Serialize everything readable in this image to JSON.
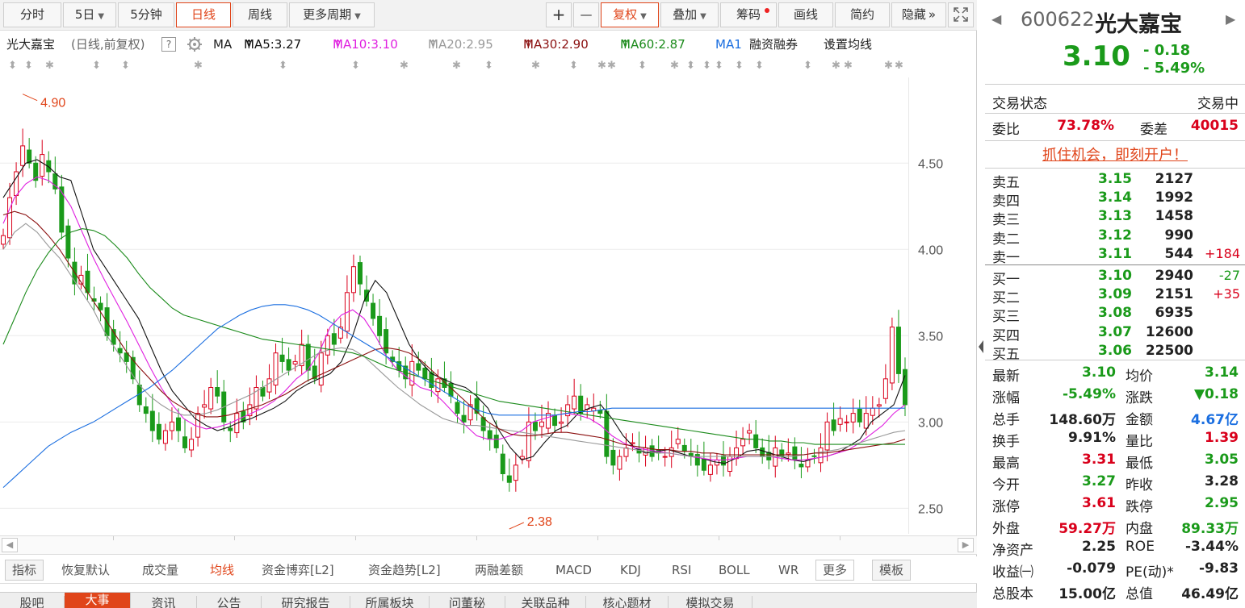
{
  "toolbar": {
    "periods": [
      "分时",
      "5日",
      "5分钟",
      "日线",
      "周线",
      "更多周期"
    ],
    "active_period": "日线",
    "tools": [
      "+",
      "—",
      "复权",
      "叠加",
      "筹码",
      "画线",
      "简约",
      "隐藏"
    ],
    "hide_arrow": "»",
    "fullscreen_icon": "fullscreen-icon"
  },
  "ma_legend": {
    "stock": "光大嘉宝",
    "mode": "(日线,前复权)",
    "help": "?",
    "label": "MA",
    "items": [
      {
        "text": "MA5:3.27",
        "arrow": "↑",
        "color": "#111111"
      },
      {
        "text": "MA10:3.10",
        "arrow": "↑",
        "color": "#e020e0"
      },
      {
        "text": "MA20:2.95",
        "arrow": "↑",
        "color": "#999999"
      },
      {
        "text": "MA30:2.90",
        "arrow": "↑",
        "color": "#8b1010"
      },
      {
        "text": "MA60:2.87",
        "arrow": "↑",
        "color": "#1a8a1a"
      },
      {
        "text": "MA1",
        "arrow": "",
        "color": "#1a6ee0"
      }
    ],
    "margin": "融资融券",
    "set_ma": "设置均线"
  },
  "marker_glyphs": [
    "⬍",
    "✱"
  ],
  "chart_data": {
    "type": "candlestick",
    "ylim": [
      2.38,
      4.95
    ],
    "yticks": [
      "4.50",
      "4.00",
      "3.50",
      "3.00",
      "2.50"
    ],
    "ytick_values": [
      4.5,
      4.0,
      3.5,
      3.0,
      2.5
    ],
    "annotations": [
      {
        "text": "4.90",
        "value": 4.9
      },
      {
        "text": "2.38",
        "value": 2.38
      }
    ],
    "colors": {
      "up": "#d9001b",
      "down": "#1a9a1a",
      "grid": "#ececec"
    },
    "close": [
      4.08,
      4.3,
      4.45,
      4.6,
      4.5,
      4.4,
      4.55,
      4.45,
      4.35,
      4.1,
      3.95,
      3.8,
      3.85,
      3.75,
      3.7,
      3.65,
      3.5,
      3.45,
      3.4,
      3.35,
      3.25,
      3.1,
      3.05,
      2.95,
      2.9,
      2.95,
      3.0,
      2.95,
      2.85,
      2.9,
      3.05,
      3.1,
      3.2,
      3.15,
      3.0,
      2.95,
      3.05,
      3.0,
      3.1,
      3.2,
      3.15,
      3.25,
      3.4,
      3.35,
      3.3,
      3.35,
      3.45,
      3.3,
      3.25,
      3.4,
      3.5,
      3.45,
      3.55,
      3.75,
      3.9,
      3.8,
      3.7,
      3.6,
      3.5,
      3.4,
      3.35,
      3.3,
      3.25,
      3.35,
      3.3,
      3.25,
      3.2,
      3.25,
      3.2,
      3.15,
      3.05,
      3.0,
      3.1,
      3.05,
      2.95,
      2.9,
      2.85,
      2.7,
      2.65,
      2.75,
      2.8,
      3.0,
      2.95,
      3.0,
      3.05,
      2.98,
      3.0,
      3.1,
      3.15,
      3.05,
      3.1,
      3.08,
      3.05,
      2.8,
      2.75,
      2.8,
      2.85,
      2.88,
      2.82,
      2.85,
      2.8,
      2.82,
      2.8,
      2.85,
      2.9,
      2.83,
      2.8,
      2.75,
      2.72,
      2.75,
      2.78,
      2.75,
      2.8,
      2.85,
      2.9,
      2.95,
      2.85,
      2.8,
      2.78,
      2.85,
      2.8,
      2.82,
      2.78,
      2.74,
      2.78,
      2.8,
      2.85,
      3.0,
      2.95,
      3.02,
      3.0,
      3.05,
      3.0,
      3.05,
      3.08,
      3.1,
      3.25,
      3.55,
      3.28,
      3.1
    ],
    "ma": [
      {
        "name": "MA5",
        "color": "#111111",
        "values": [
          4.3,
          4.4,
          4.5,
          4.52,
          4.48,
          4.42,
          4.4,
          4.2,
          4.0,
          3.9,
          3.8,
          3.7,
          3.6,
          3.45,
          3.3,
          3.18,
          3.1,
          3.02,
          2.98,
          2.95,
          2.97,
          3.0,
          3.02,
          3.05,
          3.08,
          3.12,
          3.18,
          3.22,
          3.25,
          3.28,
          3.35,
          3.5,
          3.7,
          3.82,
          3.75,
          3.6,
          3.45,
          3.35,
          3.28,
          3.25,
          3.22,
          3.2,
          3.15,
          3.08,
          2.95,
          2.85,
          2.78,
          2.8,
          2.88,
          2.95,
          2.98,
          3.05,
          3.08,
          3.1,
          3.02,
          2.92,
          2.85,
          2.82,
          2.83,
          2.84,
          2.82,
          2.8,
          2.79,
          2.77,
          2.76,
          2.79,
          2.83,
          2.84,
          2.82,
          2.8,
          2.78,
          2.77,
          2.79,
          2.8,
          2.82,
          2.86,
          2.9,
          3.0,
          3.05,
          3.1,
          3.27
        ]
      },
      {
        "name": "MA10",
        "color": "#e020e0",
        "values": [
          4.15,
          4.3,
          4.38,
          4.42,
          4.4,
          4.35,
          4.25,
          4.1,
          3.95,
          3.82,
          3.7,
          3.58,
          3.45,
          3.32,
          3.2,
          3.1,
          3.02,
          2.98,
          2.96,
          2.97,
          2.99,
          3.02,
          3.05,
          3.08,
          3.12,
          3.18,
          3.25,
          3.3,
          3.4,
          3.55,
          3.62,
          3.65,
          3.6,
          3.5,
          3.38,
          3.3,
          3.25,
          3.2,
          3.18,
          3.12,
          3.05,
          2.98,
          2.92,
          2.9,
          2.9,
          2.92,
          2.95,
          3.0,
          3.02,
          3.04,
          3.05,
          3.04,
          3.02,
          2.98,
          2.92,
          2.88,
          2.85,
          2.84,
          2.83,
          2.82,
          2.81,
          2.8,
          2.79,
          2.78,
          2.78,
          2.79,
          2.8,
          2.8,
          2.8,
          2.79,
          2.78,
          2.78,
          2.79,
          2.8,
          2.82,
          2.84,
          2.88,
          2.93,
          2.98,
          3.05,
          3.1
        ]
      },
      {
        "name": "MA20",
        "color": "#999999",
        "values": [
          4.0,
          4.1,
          4.15,
          4.1,
          4.02,
          3.95,
          3.85,
          3.75,
          3.65,
          3.52,
          3.42,
          3.32,
          3.22,
          3.15,
          3.1,
          3.06,
          3.04,
          3.04,
          3.05,
          3.07,
          3.1,
          3.13,
          3.16,
          3.2,
          3.24,
          3.28,
          3.32,
          3.36,
          3.4,
          3.42,
          3.43,
          3.42,
          3.38,
          3.32,
          3.26,
          3.2,
          3.15,
          3.1,
          3.06,
          3.02,
          3.0,
          2.98,
          2.98,
          2.97,
          2.96,
          2.95,
          2.94,
          2.93,
          2.92,
          2.91,
          2.9,
          2.89,
          2.88,
          2.87,
          2.86,
          2.85,
          2.84,
          2.83,
          2.82,
          2.82,
          2.81,
          2.8,
          2.8,
          2.8,
          2.8,
          2.8,
          2.8,
          2.8,
          2.8,
          2.8,
          2.8,
          2.81,
          2.82,
          2.83,
          2.84,
          2.86,
          2.88,
          2.9,
          2.92,
          2.94,
          2.95
        ]
      },
      {
        "name": "MA30",
        "color": "#8b1010",
        "values": [
          4.2,
          4.22,
          4.2,
          4.15,
          4.08,
          4.0,
          3.9,
          3.8,
          3.7,
          3.6,
          3.5,
          3.4,
          3.32,
          3.25,
          3.18,
          3.12,
          3.08,
          3.05,
          3.03,
          3.03,
          3.04,
          3.06,
          3.08,
          3.1,
          3.13,
          3.16,
          3.2,
          3.24,
          3.27,
          3.3,
          3.33,
          3.36,
          3.39,
          3.42,
          3.43,
          3.42,
          3.4,
          3.36,
          3.3,
          3.24,
          3.18,
          3.12,
          3.06,
          3.0,
          2.96,
          2.93,
          2.92,
          2.92,
          2.93,
          2.94,
          2.94,
          2.93,
          2.92,
          2.91,
          2.89,
          2.87,
          2.86,
          2.85,
          2.84,
          2.84,
          2.83,
          2.83,
          2.82,
          2.82,
          2.81,
          2.81,
          2.81,
          2.81,
          2.81,
          2.81,
          2.81,
          2.81,
          2.82,
          2.82,
          2.83,
          2.84,
          2.85,
          2.86,
          2.87,
          2.88,
          2.9
        ]
      },
      {
        "name": "MA60",
        "color": "#1a8a1a",
        "values": [
          3.45,
          3.6,
          3.75,
          3.88,
          3.98,
          4.06,
          4.1,
          4.12,
          4.11,
          4.08,
          4.02,
          3.95,
          3.86,
          3.78,
          3.72,
          3.66,
          3.62,
          3.6,
          3.58,
          3.56,
          3.54,
          3.52,
          3.5,
          3.48,
          3.47,
          3.46,
          3.45,
          3.44,
          3.43,
          3.42,
          3.41,
          3.4,
          3.38,
          3.35,
          3.32,
          3.3,
          3.28,
          3.26,
          3.24,
          3.22,
          3.2,
          3.18,
          3.16,
          3.14,
          3.12,
          3.11,
          3.1,
          3.09,
          3.08,
          3.07,
          3.06,
          3.05,
          3.04,
          3.03,
          3.02,
          3.01,
          3.0,
          2.99,
          2.98,
          2.97,
          2.96,
          2.95,
          2.94,
          2.93,
          2.92,
          2.91,
          2.9,
          2.9,
          2.89,
          2.89,
          2.88,
          2.88,
          2.87,
          2.87,
          2.87,
          2.87,
          2.87,
          2.87,
          2.87,
          2.87,
          2.87
        ]
      },
      {
        "name": "MA1",
        "color": "#1a6ee0",
        "values": [
          2.62,
          2.68,
          2.74,
          2.8,
          2.86,
          2.9,
          2.94,
          2.97,
          3.0,
          3.04,
          3.08,
          3.12,
          3.16,
          3.2,
          3.25,
          3.3,
          3.36,
          3.42,
          3.48,
          3.54,
          3.58,
          3.62,
          3.65,
          3.67,
          3.68,
          3.68,
          3.67,
          3.65,
          3.62,
          3.58,
          3.54,
          3.5,
          3.46,
          3.42,
          3.38,
          3.34,
          3.3,
          3.26,
          3.22,
          3.18,
          3.14,
          3.1,
          3.07,
          3.05,
          3.04,
          3.04,
          3.04,
          3.04,
          3.04,
          3.04,
          3.05,
          3.06,
          3.06,
          3.07,
          3.08,
          3.08,
          3.08,
          3.08,
          3.08,
          3.08,
          3.08,
          3.08,
          3.08,
          3.08,
          3.08,
          3.08,
          3.08,
          3.08,
          3.08,
          3.08,
          3.08,
          3.08,
          3.08,
          3.08,
          3.08,
          3.08,
          3.08,
          3.08,
          3.08,
          3.08,
          3.08
        ]
      }
    ]
  },
  "indicators": {
    "label_index": "指标",
    "label_reset": "恢复默认",
    "items": [
      "成交量",
      "均线",
      "资金博弈[L2]",
      "资金趋势[L2]",
      "两融差额",
      "MACD",
      "KDJ",
      "RSI",
      "BOLL",
      "WR"
    ],
    "active": "均线",
    "more": "更多",
    "template": "模板"
  },
  "bottom_tabs": [
    "股吧",
    "大事",
    "资讯",
    "公告",
    "研究报告",
    "所属板块",
    "问董秘",
    "关联品种",
    "核心题材",
    "模拟交易"
  ],
  "bottom_active": "大事",
  "quote": {
    "code": "600622",
    "name": "光大嘉宝",
    "price": "3.10",
    "change": "- 0.18",
    "change_pct": "- 5.49%",
    "nav_left": "◀",
    "nav_right": "▶"
  },
  "status": {
    "label": "交易状态",
    "value": "交易中"
  },
  "ratio": {
    "label1": "委比",
    "value1": "73.78%",
    "label2": "委差",
    "value2": "40015"
  },
  "promo": "抓住机会，即刻开户！",
  "orderbook": {
    "asks": [
      {
        "label": "卖五",
        "price": "3.15",
        "vol": "2127",
        "chg": ""
      },
      {
        "label": "卖四",
        "price": "3.14",
        "vol": "1992",
        "chg": ""
      },
      {
        "label": "卖三",
        "price": "3.13",
        "vol": "1458",
        "chg": ""
      },
      {
        "label": "卖二",
        "price": "3.12",
        "vol": "990",
        "chg": ""
      },
      {
        "label": "卖一",
        "price": "3.11",
        "vol": "544",
        "chg": "+184"
      }
    ],
    "bids": [
      {
        "label": "买一",
        "price": "3.10",
        "vol": "2940",
        "chg": "-27"
      },
      {
        "label": "买二",
        "price": "3.09",
        "vol": "2151",
        "chg": "+35"
      },
      {
        "label": "买三",
        "price": "3.08",
        "vol": "6935",
        "chg": ""
      },
      {
        "label": "买四",
        "price": "3.07",
        "vol": "12600",
        "chg": ""
      },
      {
        "label": "买五",
        "price": "3.06",
        "vol": "22500",
        "chg": ""
      }
    ]
  },
  "stats": [
    {
      "l1": "最新",
      "v1": "3.10",
      "c1": "#1a9a1a",
      "l2": "均价",
      "v2": "3.14",
      "c2": "#1a9a1a"
    },
    {
      "l1": "涨幅",
      "v1": "-5.49%",
      "c1": "#1a9a1a",
      "l2": "涨跌",
      "v2": "▼0.18",
      "c2": "#1a9a1a"
    },
    {
      "l1": "总手",
      "v1": "148.60万",
      "c1": "#222222",
      "l2": "金额",
      "v2": "4.67亿",
      "c2": "#1a6ee0"
    },
    {
      "l1": "换手",
      "v1": "9.91%",
      "c1": "#222222",
      "l2": "量比",
      "v2": "1.39",
      "c2": "#d9001b"
    },
    {
      "l1": "最高",
      "v1": "3.31",
      "c1": "#d9001b",
      "l2": "最低",
      "v2": "3.05",
      "c2": "#1a9a1a"
    },
    {
      "l1": "今开",
      "v1": "3.27",
      "c1": "#1a9a1a",
      "l2": "昨收",
      "v2": "3.28",
      "c2": "#222222"
    },
    {
      "l1": "涨停",
      "v1": "3.61",
      "c1": "#d9001b",
      "l2": "跌停",
      "v2": "2.95",
      "c2": "#1a9a1a"
    },
    {
      "l1": "外盘",
      "v1": "59.27万",
      "c1": "#d9001b",
      "l2": "内盘",
      "v2": "89.33万",
      "c2": "#1a9a1a"
    },
    {
      "l1": "净资产",
      "v1": "2.25",
      "c1": "#222222",
      "l2": "ROE",
      "v2": "-3.44%",
      "c2": "#222222"
    },
    {
      "l1": "收益㈠",
      "v1": "-0.079",
      "c1": "#222222",
      "l2": "PE(动)*",
      "v2": "-9.83",
      "c2": "#222222"
    },
    {
      "l1": "总股本",
      "v1": "15.00亿",
      "c1": "#222222",
      "l2": "总值",
      "v2": "46.49亿",
      "c2": "#222222"
    }
  ]
}
